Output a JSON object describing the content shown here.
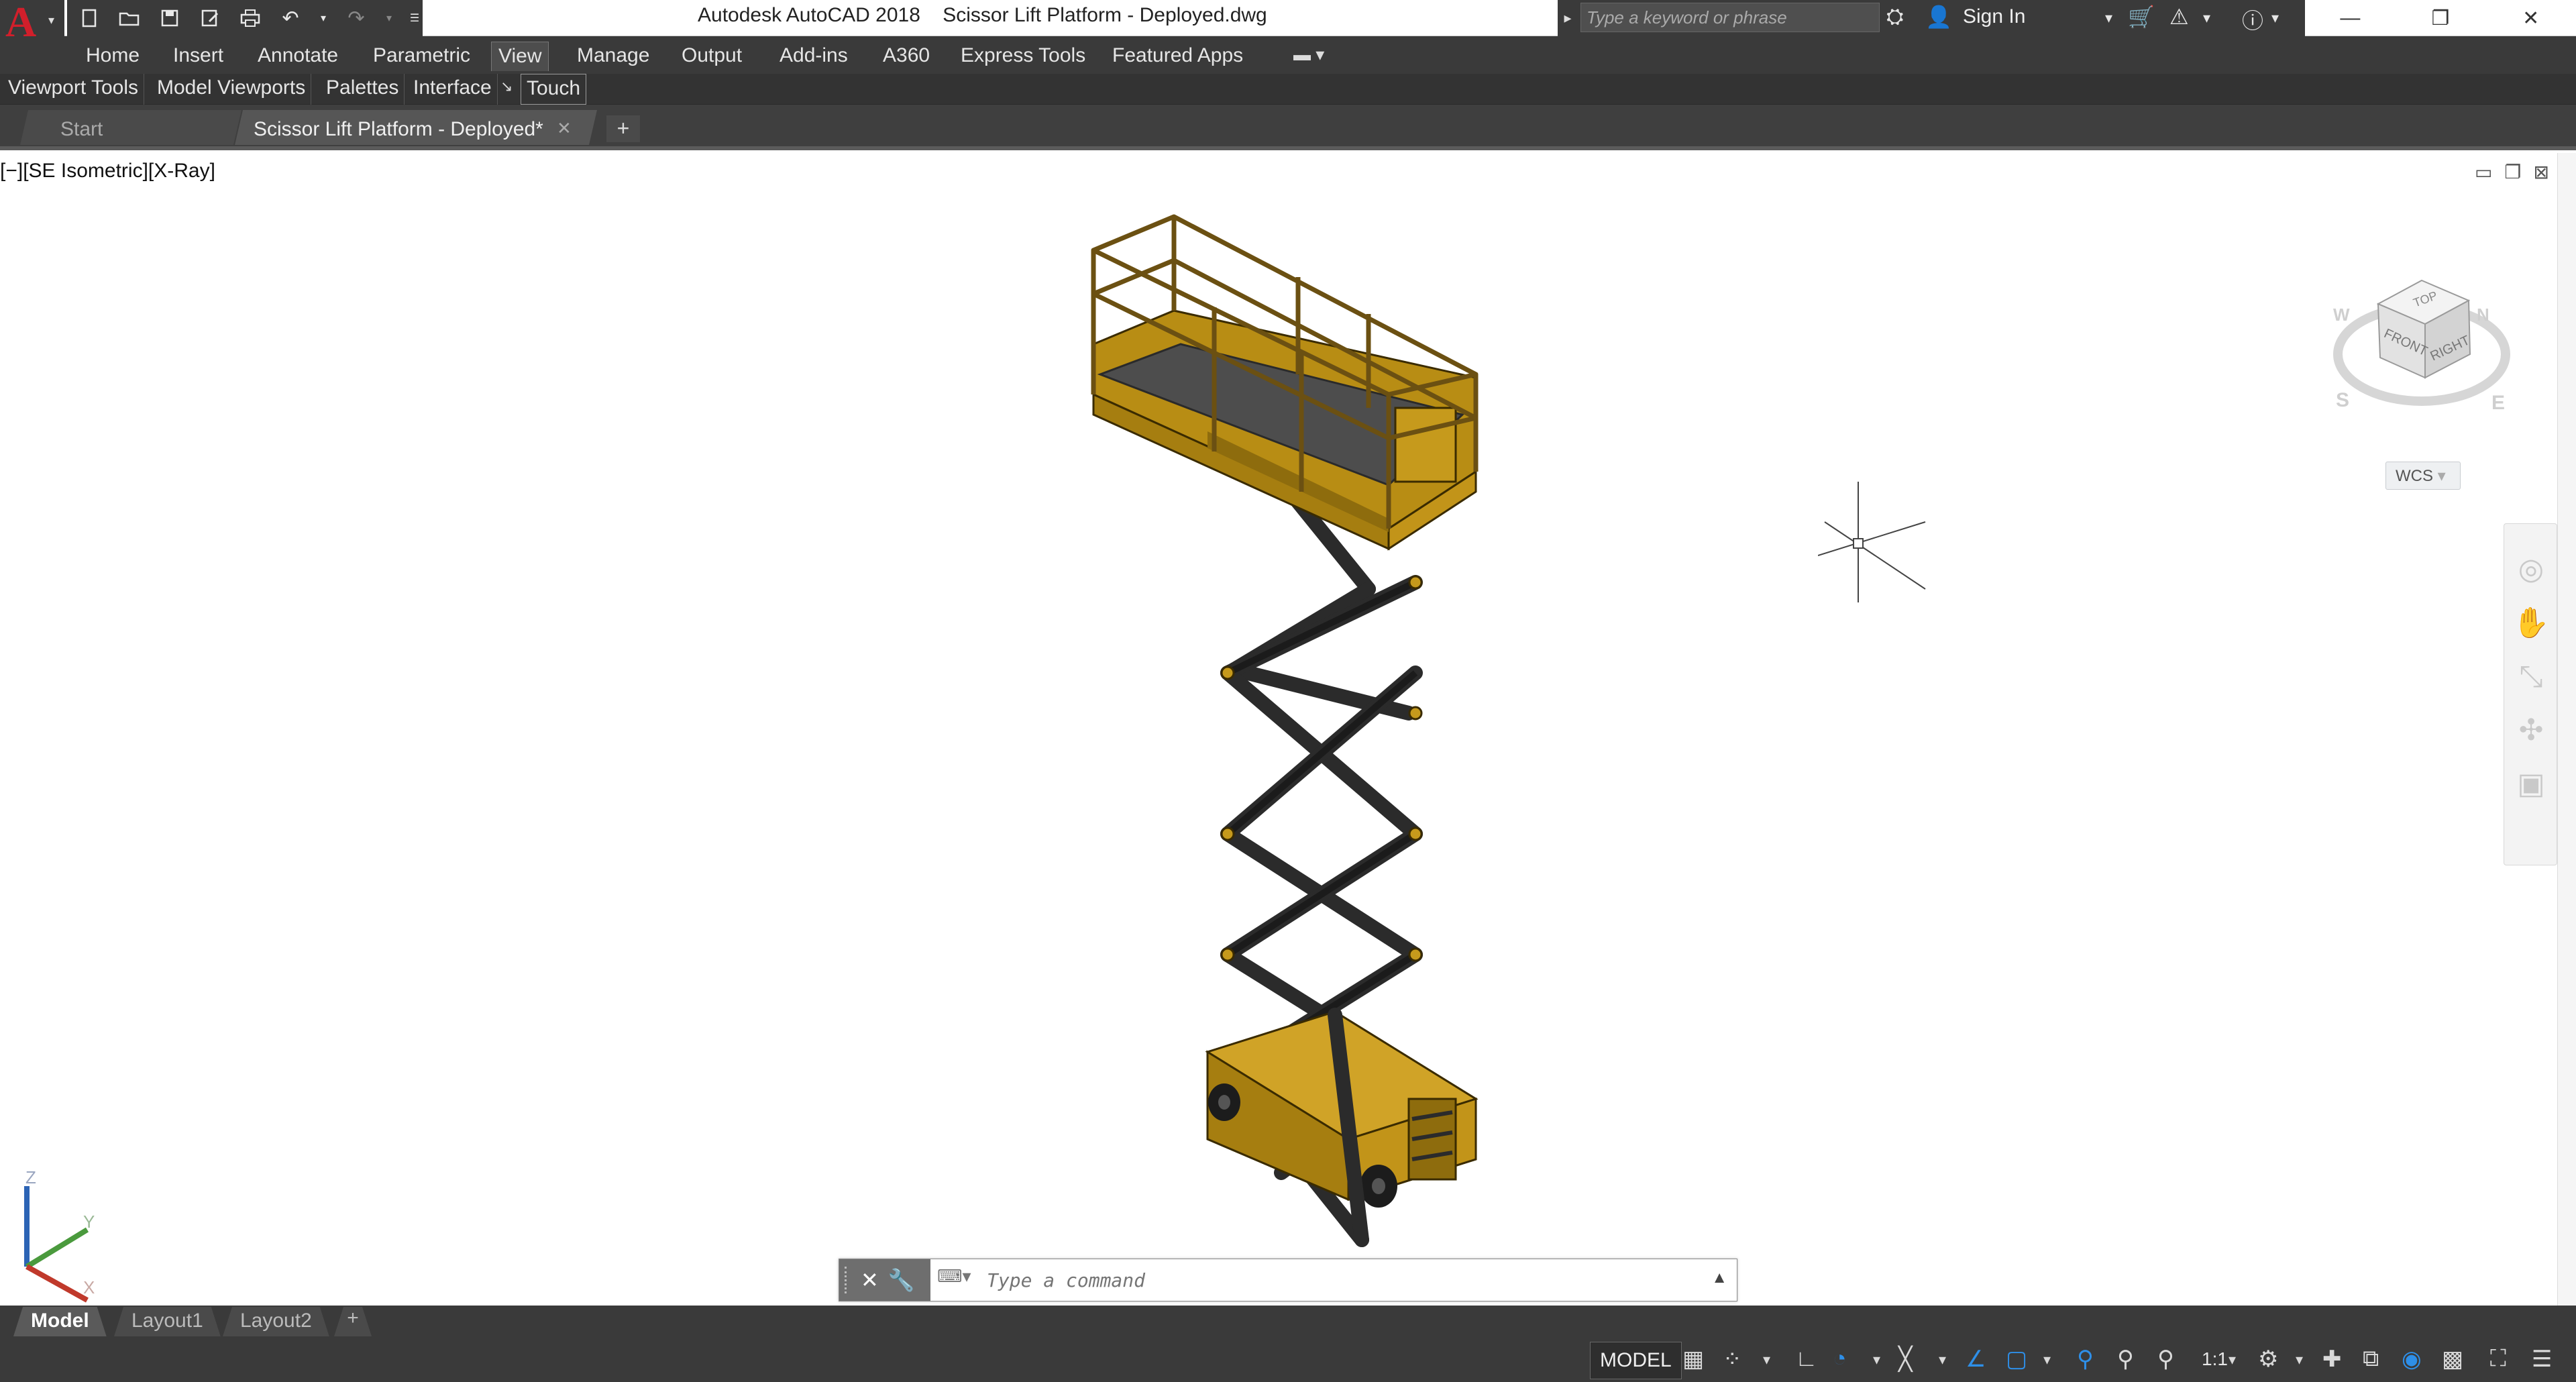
{
  "app": {
    "window_title": "Autodesk AutoCAD 2018    Scissor Lift Platform - Deployed.dwg",
    "logo_letter": "A"
  },
  "quick_access": [
    {
      "name": "new-icon",
      "glyph": "▭"
    },
    {
      "name": "open-icon",
      "glyph": "🗁"
    },
    {
      "name": "save-icon",
      "glyph": "🖫"
    },
    {
      "name": "save-as-icon",
      "glyph": "🖉"
    },
    {
      "name": "print-icon",
      "glyph": "🖶"
    },
    {
      "name": "undo-icon",
      "glyph": "↶"
    },
    {
      "name": "redo-icon",
      "glyph": "↷"
    }
  ],
  "search": {
    "placeholder": "Type a keyword or phrase"
  },
  "header": {
    "sign_in": "Sign In"
  },
  "ribbon_tabs": [
    "Home",
    "Insert",
    "Annotate",
    "Parametric",
    "View",
    "Manage",
    "Output",
    "Add-ins",
    "A360",
    "Express Tools",
    "Featured Apps"
  ],
  "active_ribbon_tab": "View",
  "ribbon_panels": [
    "Viewport Tools",
    "Model Viewports",
    "Palettes",
    "Interface",
    "Touch"
  ],
  "file_tabs": {
    "start": "Start",
    "drawing": "Scissor Lift Platform - Deployed*"
  },
  "viewport": {
    "label": "[−][SE Isometric][X-Ray]"
  },
  "viewcube": {
    "top": "TOP",
    "front": "FRONT",
    "right": "RIGHT",
    "north": "N",
    "south": "S",
    "east": "E",
    "west": "W"
  },
  "wcs": {
    "label": "WCS"
  },
  "ucs": {
    "x": "X",
    "y": "Y",
    "z": "Z"
  },
  "command": {
    "placeholder": "Type a command"
  },
  "layout_tabs": [
    "Model",
    "Layout1",
    "Layout2"
  ],
  "active_layout": "Model",
  "status": {
    "model": "MODEL",
    "scale": "1:1"
  },
  "colors": {
    "lift_yellow": "#c69a1c",
    "lift_dark": "#2b2b2b",
    "accent_blue": "#2e8fe8",
    "ui_dark": "#3a3a3a"
  }
}
